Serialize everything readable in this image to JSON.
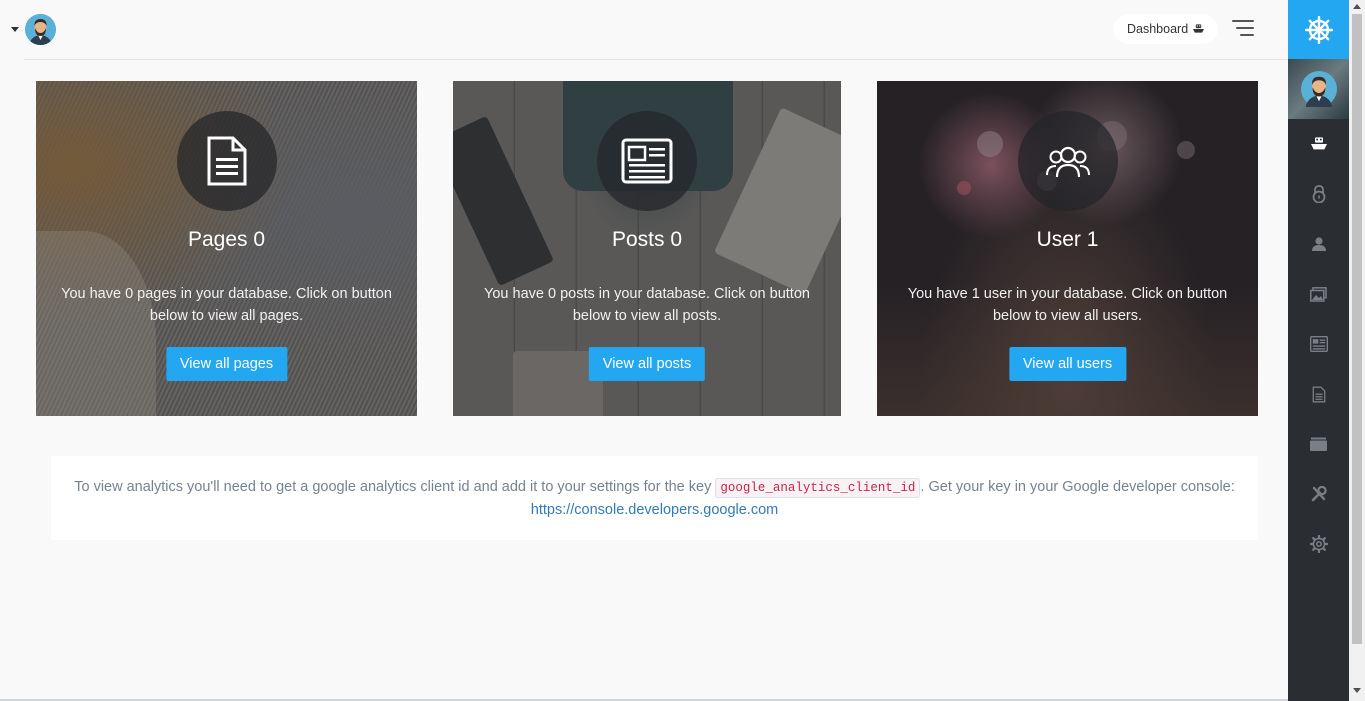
{
  "header": {
    "breadcrumb_label": "Dashboard",
    "breadcrumb_icon": "boat-icon",
    "menu_icon": "hamburger-icon"
  },
  "sidebar": {
    "logo_icon": "helm-icon",
    "accent": "#22a7f0",
    "items": [
      {
        "name": "dashboard",
        "icon": "boat-icon"
      },
      {
        "name": "roles",
        "icon": "lock-icon"
      },
      {
        "name": "users",
        "icon": "person-icon"
      },
      {
        "name": "media",
        "icon": "images-icon"
      },
      {
        "name": "posts",
        "icon": "news-icon"
      },
      {
        "name": "pages",
        "icon": "file-text-icon"
      },
      {
        "name": "categories",
        "icon": "categories-icon"
      },
      {
        "name": "tools",
        "icon": "tools-icon"
      },
      {
        "name": "settings",
        "icon": "gear-icon"
      }
    ]
  },
  "cards": [
    {
      "icon": "file-text-icon",
      "title": "Pages 0",
      "desc_line1": "You have 0 pages in your database. Click on button",
      "desc_line2": ".below to view all pages",
      "button": "View all pages"
    },
    {
      "icon": "news-icon",
      "title": "Posts 0",
      "desc_line1": "You have 0 posts in your database. Click on button",
      "desc_line2": ".below to view all posts",
      "button": "View all posts"
    },
    {
      "icon": "group-icon",
      "title": "User 1",
      "desc_line1": "You have 1 user in your database. Click on button",
      "desc_line2": ".below to view all users",
      "button": "View all users"
    }
  ],
  "analytics": {
    "text_before": "To view analytics you'll need to get a google analytics client id and add it to your settings for the key",
    "key": "google_analytics_client_id",
    "text_after": ". Get your key in your Google developer console:",
    "link": "https://console.developers.google.com"
  }
}
